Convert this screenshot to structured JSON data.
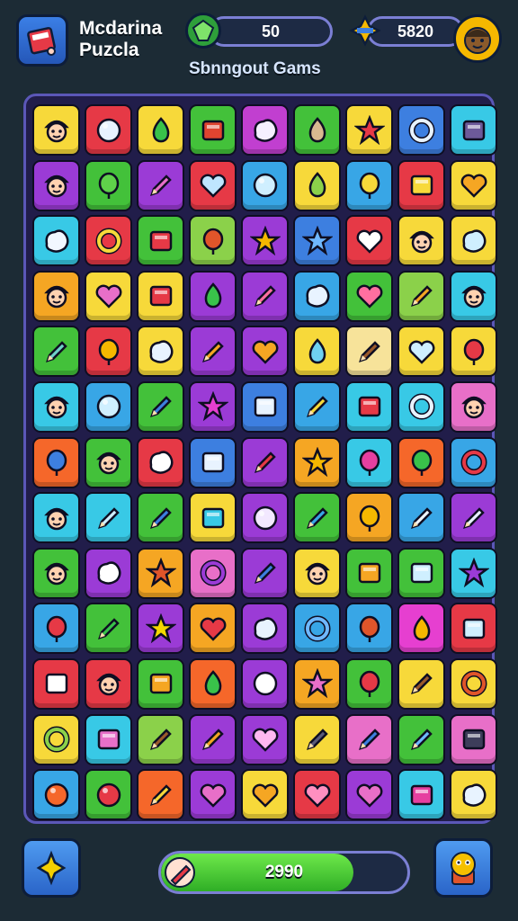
{
  "header": {
    "title_line1": "Mcdarina",
    "title_line2": "Puzcla",
    "subtitle": "Sbnngout Gams",
    "app_icon": "puzzle-box-icon",
    "coins": {
      "value": "50",
      "icon": "green-gem-icon"
    },
    "score": {
      "value": "5820",
      "icon": "star-badge-icon"
    },
    "avatar_icon": "player-avatar-icon"
  },
  "board": {
    "rows": [
      [
        {
          "c": "#f7d93a",
          "i": "face"
        },
        {
          "c": "#e63946",
          "i": "circle",
          "ic": "#e8f3ff"
        },
        {
          "c": "#f7d93a",
          "i": "drop",
          "ic": "#39c24a"
        },
        {
          "c": "#43c13a",
          "i": "square",
          "ic": "#e04430"
        },
        {
          "c": "#c13fd0",
          "i": "blob",
          "ic": "#f5f0ff"
        },
        {
          "c": "#43c13a",
          "i": "drop",
          "ic": "#d8b890"
        },
        {
          "c": "#f7d93a",
          "i": "star",
          "ic": "#e63946"
        },
        {
          "c": "#3d7fe0",
          "i": "ring",
          "ic": "#e8f3ff"
        },
        {
          "c": "#38c9e6",
          "i": "square",
          "ic": "#6d5a9a"
        }
      ],
      [
        {
          "c": "#9b3bd6",
          "i": "face",
          "ic": "#b8b8c8"
        },
        {
          "c": "#43c13a",
          "i": "balloon",
          "ic": "#5fd14a"
        },
        {
          "c": "#9b3bd6",
          "i": "pencil",
          "ic": "#e86fc8"
        },
        {
          "c": "#e63946",
          "i": "heart",
          "ic": "#bfe6ff"
        },
        {
          "c": "#38a6e6",
          "i": "circle",
          "ic": "#cfefff"
        },
        {
          "c": "#f7d93a",
          "i": "drop",
          "ic": "#8bd14a"
        },
        {
          "c": "#38a6e6",
          "i": "balloon",
          "ic": "#f7d93a"
        },
        {
          "c": "#e63946",
          "i": "square",
          "ic": "#f7d93a"
        },
        {
          "c": "#f7d93a",
          "i": "heart",
          "ic": "#f5a623"
        }
      ],
      [
        {
          "c": "#38c9e6",
          "i": "blob",
          "ic": "#f2f7ff"
        },
        {
          "c": "#e63946",
          "i": "ring",
          "ic": "#f7d93a"
        },
        {
          "c": "#43c13a",
          "i": "square",
          "ic": "#e63946"
        },
        {
          "c": "#8bd14a",
          "i": "balloon",
          "ic": "#e0552a"
        },
        {
          "c": "#9b3bd6",
          "i": "star",
          "ic": "#f5b800"
        },
        {
          "c": "#3d7fe0",
          "i": "star",
          "ic": "#6fb8ff"
        },
        {
          "c": "#e63946",
          "i": "heart",
          "ic": "#ffffff"
        },
        {
          "c": "#f7d93a",
          "i": "face"
        },
        {
          "c": "#f7d93a",
          "i": "blob",
          "ic": "#cfefff"
        }
      ],
      [
        {
          "c": "#f5a623",
          "i": "face",
          "ic": "#8b5a2b"
        },
        {
          "c": "#f7d93a",
          "i": "heart",
          "ic": "#e86fc8"
        },
        {
          "c": "#f7d93a",
          "i": "square",
          "ic": "#e63946"
        },
        {
          "c": "#9b3bd6",
          "i": "drop",
          "ic": "#39c24a"
        },
        {
          "c": "#9b3bd6",
          "i": "pencil",
          "ic": "#ff6fa0"
        },
        {
          "c": "#38a6e6",
          "i": "blob",
          "ic": "#e8f3ff"
        },
        {
          "c": "#43c13a",
          "i": "heart",
          "ic": "#ff6fa0"
        },
        {
          "c": "#8bd14a",
          "i": "pencil",
          "ic": "#f5a623"
        },
        {
          "c": "#38c9e6",
          "i": "face",
          "ic": "#8b5a2b"
        }
      ],
      [
        {
          "c": "#43c13a",
          "i": "pencil",
          "ic": "#6fd1c8"
        },
        {
          "c": "#e63946",
          "i": "balloon",
          "ic": "#f5b800"
        },
        {
          "c": "#f7d93a",
          "i": "blob",
          "ic": "#e8f3ff"
        },
        {
          "c": "#9b3bd6",
          "i": "pencil",
          "ic": "#f5a623"
        },
        {
          "c": "#9b3bd6",
          "i": "heart",
          "ic": "#f5a623"
        },
        {
          "c": "#f7d93a",
          "i": "drop",
          "ic": "#6fd1f0"
        },
        {
          "c": "#f7e39a",
          "i": "pencil",
          "ic": "#9b5a2b"
        },
        {
          "c": "#f7d93a",
          "i": "heart",
          "ic": "#cfefff"
        },
        {
          "c": "#f7d93a",
          "i": "balloon",
          "ic": "#e63946"
        }
      ],
      [
        {
          "c": "#38c9e6",
          "i": "face",
          "ic": "#e63946"
        },
        {
          "c": "#38a6e6",
          "i": "circle",
          "ic": "#cfefff"
        },
        {
          "c": "#43c13a",
          "i": "pencil",
          "ic": "#3d7fe0"
        },
        {
          "c": "#9b3bd6",
          "i": "star",
          "ic": "#e63fd0"
        },
        {
          "c": "#3d7fe0",
          "i": "square",
          "ic": "#e8f3ff"
        },
        {
          "c": "#38a6e6",
          "i": "pencil",
          "ic": "#f7d93a"
        },
        {
          "c": "#38c9e6",
          "i": "square",
          "ic": "#e63946"
        },
        {
          "c": "#38c9e6",
          "i": "ring",
          "ic": "#e8f3ff"
        },
        {
          "c": "#e86fc8",
          "i": "face",
          "ic": "#3b2a1a"
        }
      ],
      [
        {
          "c": "#f5672a",
          "i": "balloon",
          "ic": "#3d7fe0"
        },
        {
          "c": "#43c13a",
          "i": "face",
          "ic": "#f7d93a"
        },
        {
          "c": "#e63946",
          "i": "blob",
          "ic": "#ffffff"
        },
        {
          "c": "#3d7fe0",
          "i": "square",
          "ic": "#e8f3ff"
        },
        {
          "c": "#9b3bd6",
          "i": "pencil",
          "ic": "#e63946"
        },
        {
          "c": "#f5a623",
          "i": "star",
          "ic": "#f5b800"
        },
        {
          "c": "#38c9e6",
          "i": "balloon",
          "ic": "#e63fa0"
        },
        {
          "c": "#f5672a",
          "i": "balloon",
          "ic": "#39c24a"
        },
        {
          "c": "#38a6e6",
          "i": "ring",
          "ic": "#e63946"
        }
      ],
      [
        {
          "c": "#38c9e6",
          "i": "face",
          "ic": "#e63946"
        },
        {
          "c": "#38c9e6",
          "i": "pencil",
          "ic": "#cfefff"
        },
        {
          "c": "#43c13a",
          "i": "pencil",
          "ic": "#3d7fe0"
        },
        {
          "c": "#f7d93a",
          "i": "square",
          "ic": "#38c9e6"
        },
        {
          "c": "#9b3bd6",
          "i": "circle",
          "ic": "#f2e8ff"
        },
        {
          "c": "#43c13a",
          "i": "pencil",
          "ic": "#38a6e6"
        },
        {
          "c": "#f5a623",
          "i": "balloon",
          "ic": "#f5b800"
        },
        {
          "c": "#38a6e6",
          "i": "pencil",
          "ic": "#f2f7ff"
        },
        {
          "c": "#9b3bd6",
          "i": "pencil",
          "ic": "#e8f3ff"
        }
      ],
      [
        {
          "c": "#43c13a",
          "i": "face",
          "ic": "#3d7fe0"
        },
        {
          "c": "#9b3bd6",
          "i": "blob",
          "ic": "#ffffff"
        },
        {
          "c": "#f5a623",
          "i": "star",
          "ic": "#e0552a"
        },
        {
          "c": "#e86fc8",
          "i": "ring",
          "ic": "#9b3bd6"
        },
        {
          "c": "#9b3bd6",
          "i": "pencil",
          "ic": "#3d7fe0"
        },
        {
          "c": "#f7d93a",
          "i": "face"
        },
        {
          "c": "#43c13a",
          "i": "square",
          "ic": "#f5a623"
        },
        {
          "c": "#43c13a",
          "i": "square",
          "ic": "#cfefff"
        },
        {
          "c": "#38c9e6",
          "i": "star",
          "ic": "#9b3bd6"
        }
      ],
      [
        {
          "c": "#38a6e6",
          "i": "balloon",
          "ic": "#e63946"
        },
        {
          "c": "#43c13a",
          "i": "pencil",
          "ic": "#39c24a"
        },
        {
          "c": "#9b3bd6",
          "i": "star",
          "ic": "#f5d800"
        },
        {
          "c": "#f5a623",
          "i": "heart",
          "ic": "#e63946"
        },
        {
          "c": "#9b3bd6",
          "i": "blob",
          "ic": "#e8f3ff"
        },
        {
          "c": "#38a6e6",
          "i": "ring",
          "ic": "#6fb8ff"
        },
        {
          "c": "#38a6e6",
          "i": "balloon",
          "ic": "#e0552a"
        },
        {
          "c": "#e63fd0",
          "i": "drop",
          "ic": "#f5b800"
        },
        {
          "c": "#e63946",
          "i": "square",
          "ic": "#cfefff"
        }
      ],
      [
        {
          "c": "#e63946",
          "i": "square",
          "ic": "#ffffff"
        },
        {
          "c": "#e63946",
          "i": "face",
          "ic": "#c8d0e0"
        },
        {
          "c": "#43c13a",
          "i": "square",
          "ic": "#f5a623"
        },
        {
          "c": "#f5672a",
          "i": "drop",
          "ic": "#39c24a"
        },
        {
          "c": "#9b3bd6",
          "i": "circle",
          "ic": "#ffffff"
        },
        {
          "c": "#f5a623",
          "i": "star",
          "ic": "#e86fc8"
        },
        {
          "c": "#43c13a",
          "i": "balloon",
          "ic": "#e63946"
        },
        {
          "c": "#f7d93a",
          "i": "pencil",
          "ic": "#9b5a2b"
        },
        {
          "c": "#f7d93a",
          "i": "ring",
          "ic": "#e0552a"
        }
      ],
      [
        {
          "c": "#f7d93a",
          "i": "ring",
          "ic": "#8bd14a"
        },
        {
          "c": "#38c9e6",
          "i": "square",
          "ic": "#e86fc8"
        },
        {
          "c": "#8bd14a",
          "i": "pencil",
          "ic": "#9b5a2b"
        },
        {
          "c": "#9b3bd6",
          "i": "pencil",
          "ic": "#f5a623"
        },
        {
          "c": "#9b3bd6",
          "i": "heart",
          "ic": "#ffb8f0"
        },
        {
          "c": "#f7d93a",
          "i": "pencil",
          "ic": "#5a5a7a"
        },
        {
          "c": "#e86fc8",
          "i": "pencil",
          "ic": "#3d7fe0"
        },
        {
          "c": "#43c13a",
          "i": "pencil",
          "ic": "#6fb8ff"
        },
        {
          "c": "#e86fc8",
          "i": "square",
          "ic": "#3d3d5a"
        }
      ],
      [
        {
          "c": "#38a6e6",
          "i": "circle",
          "ic": "#f5672a"
        },
        {
          "c": "#43c13a",
          "i": "circle",
          "ic": "#e63946"
        },
        {
          "c": "#f5672a",
          "i": "pencil",
          "ic": "#f7d93a"
        },
        {
          "c": "#9b3bd6",
          "i": "heart",
          "ic": "#e86fc8"
        },
        {
          "c": "#f7d93a",
          "i": "heart",
          "ic": "#f5a623"
        },
        {
          "c": "#e63946",
          "i": "heart",
          "ic": "#ff8fc0"
        },
        {
          "c": "#9b3bd6",
          "i": "heart",
          "ic": "#e86fc8"
        },
        {
          "c": "#38c9e6",
          "i": "square",
          "ic": "#e63fa0"
        },
        {
          "c": "#f7d93a",
          "i": "blob",
          "ic": "#e8f3ff"
        }
      ]
    ]
  },
  "footer": {
    "left_button_icon": "hint-star-icon",
    "right_button_icon": "mascot-icon",
    "progress_text": "2990",
    "progress_fraction": 0.78,
    "progress_icon": "pencil-progress-icon"
  }
}
